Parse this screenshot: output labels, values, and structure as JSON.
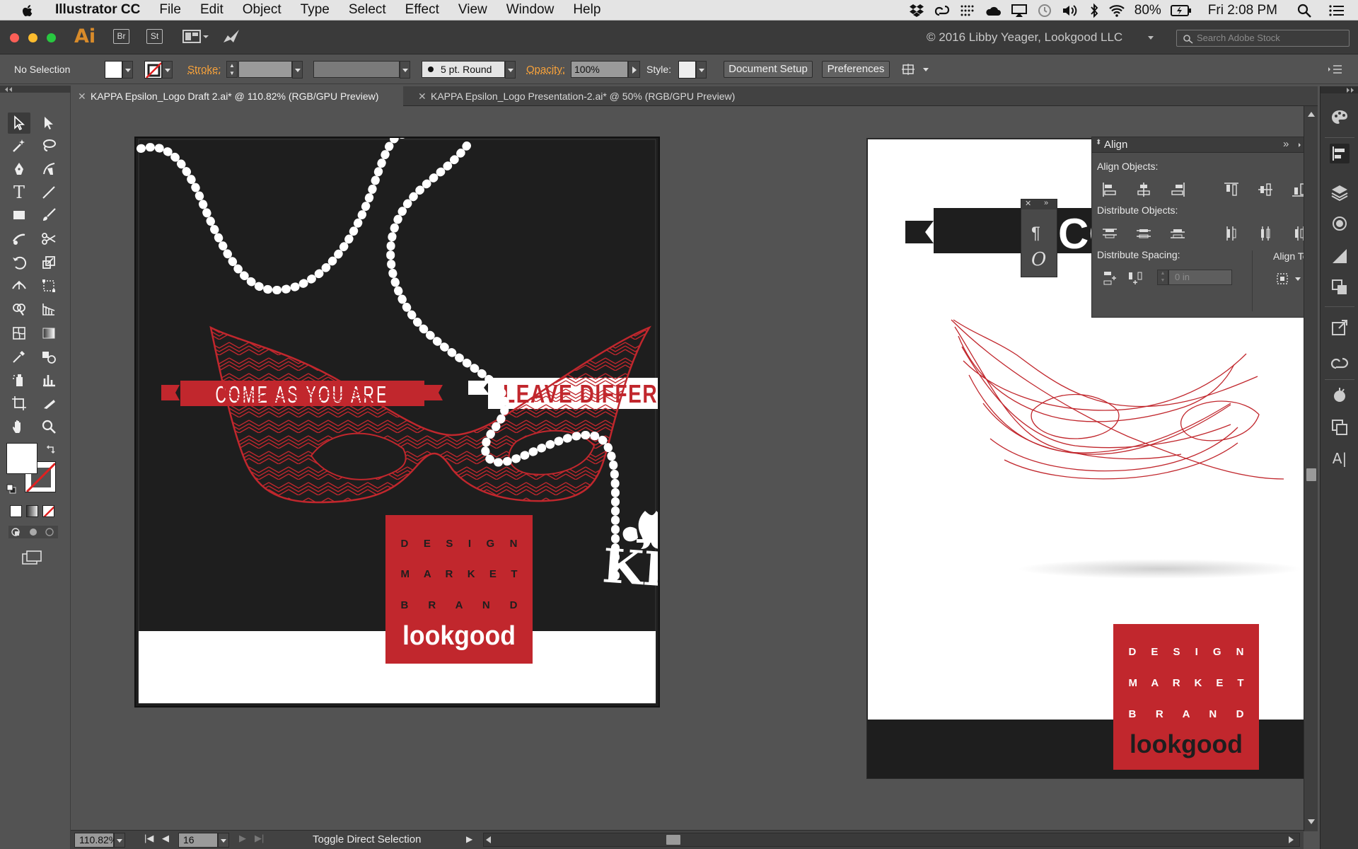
{
  "menubar": {
    "app_name": "Illustrator CC",
    "items": [
      "File",
      "Edit",
      "Object",
      "Type",
      "Select",
      "Effect",
      "View",
      "Window",
      "Help"
    ],
    "battery": "80%",
    "clock": "Fri 2:08 PM"
  },
  "appbar": {
    "logo": "Ai",
    "bridge": "Br",
    "stock": "St",
    "workspace_owner": "© 2016 Libby Yeager, Lookgood LLC",
    "search_placeholder": "Search Adobe Stock"
  },
  "controlbar": {
    "selection": "No Selection",
    "stroke_label": "Stroke:",
    "brush": "5 pt. Round",
    "opacity_label": "Opacity:",
    "opacity_value": "100%",
    "style_label": "Style:",
    "document_setup": "Document Setup",
    "preferences": "Preferences"
  },
  "tabs": [
    {
      "label": "KAPPA Epsilon_Logo Draft 2.ai* @ 110.82% (RGB/GPU Preview)",
      "active": true
    },
    {
      "label": "KAPPA Epsilon_Logo Presentation-2.ai* @ 50% (RGB/GPU Preview)",
      "active": false
    }
  ],
  "artboard1": {
    "banner_left": "COME AS YOU ARE",
    "banner_right": "LEAVE DIFFERENT",
    "monogram": "KE",
    "logo_lines": [
      "D E S I G N",
      "M A R K E T",
      "B R A N D"
    ],
    "logo_word": "lookgood"
  },
  "artboard2": {
    "banner_partial": "CO",
    "logo_lines": [
      "D E S I G N",
      "M A R K E T",
      "B R A N D"
    ],
    "logo_word": "lookgood"
  },
  "align_panel": {
    "title": "Align",
    "align_objects": "Align Objects:",
    "distribute_objects": "Distribute Objects:",
    "distribute_spacing": "Distribute Spacing:",
    "align_to": "Align To:",
    "spacing_value": "0 in"
  },
  "statusbar": {
    "zoom": "110.82%",
    "artboard_number": "16",
    "status_text": "Toggle Direct Selection"
  },
  "colors": {
    "accent_red": "#c1272d",
    "artboard_dark": "#1e1e1e",
    "ui_gray": "#535353",
    "orange_label": "#f7a23b"
  }
}
